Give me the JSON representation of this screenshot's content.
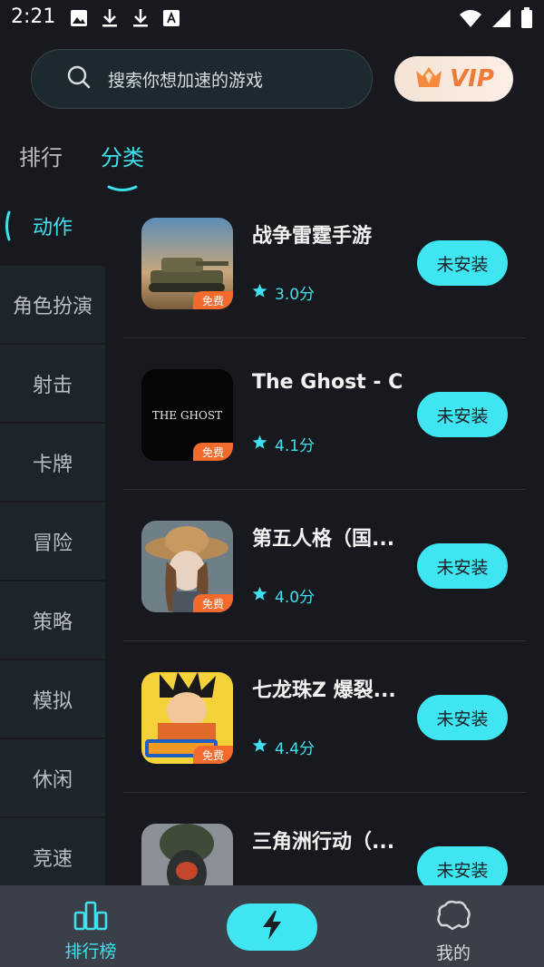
{
  "status_bar": {
    "time": "2:21"
  },
  "search": {
    "placeholder": "搜索你想加速的游戏"
  },
  "vip": {
    "label": "VIP"
  },
  "tabs": [
    {
      "label": "排行",
      "active": false
    },
    {
      "label": "分类",
      "active": true
    }
  ],
  "categories": [
    "动作",
    "角色扮演",
    "射击",
    "卡牌",
    "冒险",
    "策略",
    "模拟",
    "休闲",
    "竞速"
  ],
  "games": [
    {
      "name": "战争雷霆手游",
      "rating": "3.0分",
      "badge": "免费",
      "button": "未安装",
      "icon": "tank-game-icon"
    },
    {
      "name": "The Ghost - C...",
      "rating": "4.1分",
      "badge": "免费",
      "button": "未安装",
      "icon": "the-ghost-icon",
      "icon_text": "THE GHOST"
    },
    {
      "name": "第五人格（国...",
      "rating": "4.0分",
      "badge": "免费",
      "button": "未安装",
      "icon": "identity-v-icon"
    },
    {
      "name": "七龙珠Z 爆裂...",
      "rating": "4.4分",
      "badge": "免费",
      "button": "未安装",
      "icon": "dragon-ball-icon"
    },
    {
      "name": "三角洲行动（...",
      "rating": "",
      "badge": "",
      "button": "未安装",
      "icon": "delta-force-icon"
    }
  ],
  "bottom_nav": {
    "rank_label": "排行榜",
    "mine_label": "我的"
  },
  "colors": {
    "accent": "#3fe1ef",
    "background": "#17191e",
    "badge": "#f26b2d",
    "vip_text": "#f07a36"
  }
}
